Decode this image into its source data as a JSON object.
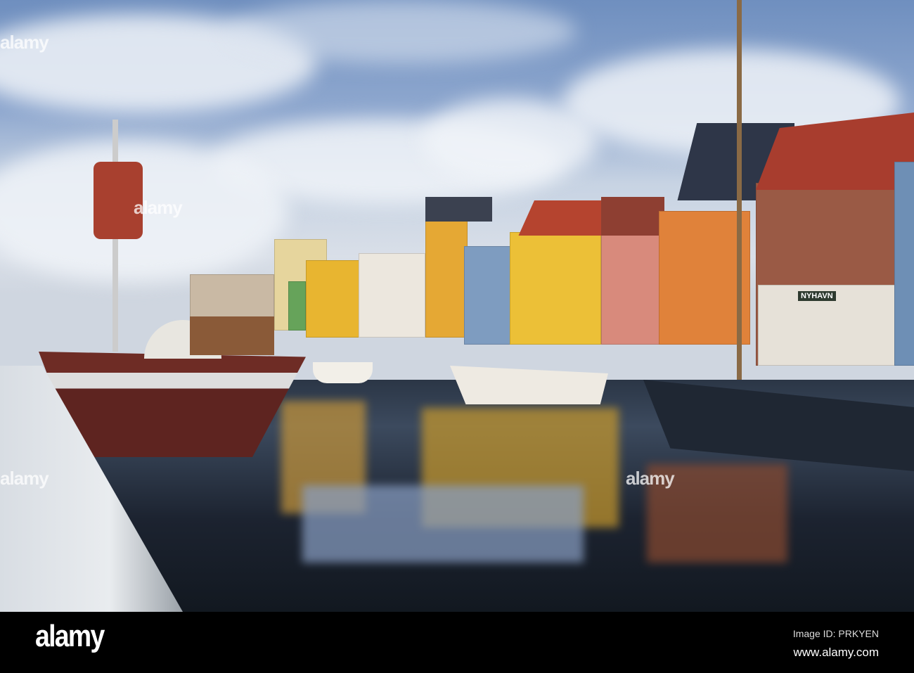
{
  "scene": {
    "colors": {
      "sky": "#8fa8cf",
      "water": "#2b3646",
      "yellow": "#e8b530",
      "orange": "#e0823a",
      "brick": "#9a5a45",
      "blue": "#6e8fb5"
    },
    "shop_sign": "NYHAVN"
  },
  "watermarks": [
    "alamy",
    "alamy",
    "alamy",
    "alamy",
    "alamy",
    "alamy",
    "alamy",
    "alamy",
    "alamy",
    "alamy",
    "alamy",
    "alamy",
    "alamy",
    "alamy"
  ],
  "footer": {
    "logo": "alamy",
    "image_id": "Image ID: PRKYEN",
    "website": "www.alamy.com"
  }
}
